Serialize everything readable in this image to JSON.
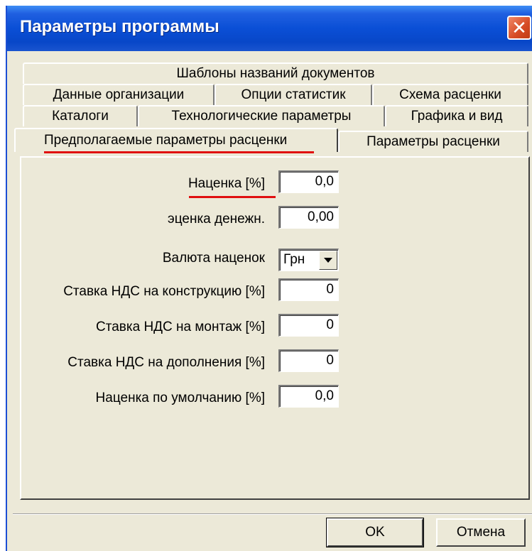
{
  "window": {
    "title": "Параметры программы",
    "close_glyph": "✕"
  },
  "tabs": {
    "row1": [
      "Шаблоны названий документов"
    ],
    "row2": [
      "Данные организации",
      "Опции статистик",
      "Схема расценки"
    ],
    "row3": [
      "Каталоги",
      "Технологические параметры",
      "Графика и вид"
    ],
    "row4": [
      "Предполагаемые параметры расценки",
      "Параметры расценки"
    ],
    "active": "Предполагаемые параметры расценки"
  },
  "fields": [
    {
      "label": "Наценка [%]",
      "value": "0,0"
    },
    {
      "label": "эценка денежн.",
      "value": "0,00"
    },
    {
      "label": "Валюта наценок",
      "value": "Грн"
    },
    {
      "label": "Ставка НДС на конструкцию [%]",
      "value": "0"
    },
    {
      "label": "Ставка НДС на монтаж [%]",
      "value": "0"
    },
    {
      "label": "Ставка НДС на дополнения [%]",
      "value": "0"
    },
    {
      "label": "Наценка по умолчанию [%]",
      "value": "0,0"
    }
  ],
  "buttons": {
    "ok": "OK",
    "cancel": "Отмена"
  },
  "colors": {
    "titlebar": "#0a4fd6",
    "dialog_face": "#ece9d8",
    "highlight_underline": "#e01010"
  },
  "icons": {
    "close": "close-icon",
    "dropdown": "chevron-down-icon"
  }
}
